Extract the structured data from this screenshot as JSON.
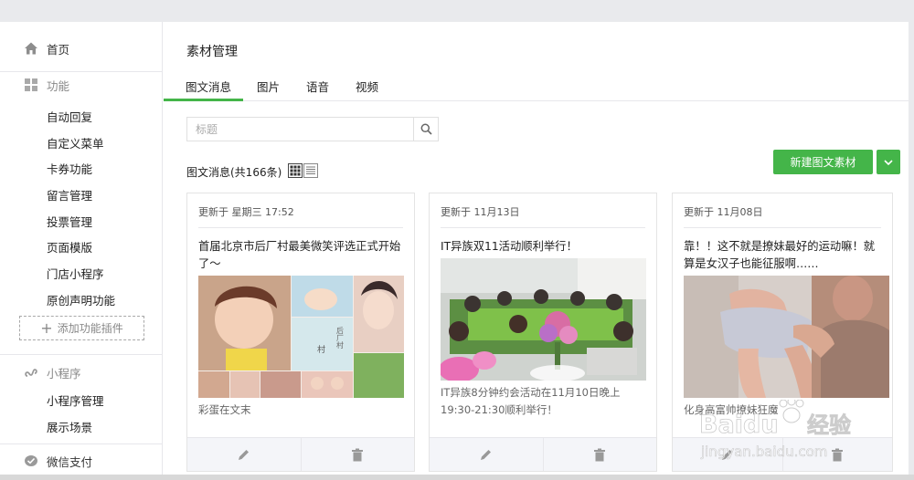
{
  "sidebar": {
    "home": "首页",
    "features": {
      "title": "功能",
      "items": [
        "自动回复",
        "自定义菜单",
        "卡券功能",
        "留言管理",
        "投票管理",
        "页面模版",
        "门店小程序",
        "原创声明功能"
      ],
      "add_plugin": "添加功能插件"
    },
    "miniprogram": {
      "title": "小程序",
      "items": [
        "小程序管理",
        "展示场景"
      ]
    },
    "wechat_pay": "微信支付"
  },
  "main": {
    "title": "素材管理",
    "tabs": [
      {
        "label": "图文消息",
        "active": true
      },
      {
        "label": "图片",
        "active": false
      },
      {
        "label": "语音",
        "active": false
      },
      {
        "label": "视频",
        "active": false
      }
    ],
    "search": {
      "placeholder": "标题",
      "value": ""
    },
    "count_label": "图文消息(共166条)",
    "new_button": "新建图文素材"
  },
  "cards": [
    {
      "date": "更新于 星期三 17:52",
      "title": "首届北京市后厂村最美微笑评选正式开始了～",
      "digest": "彩蛋在文末"
    },
    {
      "date": "更新于 11月13日",
      "title": "IT异族双11活动顺利举行！",
      "digest": "IT异族8分钟约会活动在11月10日晚上19:30-21:30顺利举行！"
    },
    {
      "date": "更新于 11月08日",
      "title": "靠！！这不就是撩妹最好的运动嘛！就算是女汉子也能征服啊……",
      "digest": "化身高富帅撩妹狂魔"
    }
  ],
  "collage_text": [
    "村",
    "后厂村"
  ],
  "watermark": {
    "brand": "Baidu",
    "cn": "经验",
    "url": "jingyan.baidu.com"
  },
  "colors": {
    "accent": "#44b549",
    "border": "#e7e7eb",
    "actions_bg": "#f4f5f9"
  }
}
